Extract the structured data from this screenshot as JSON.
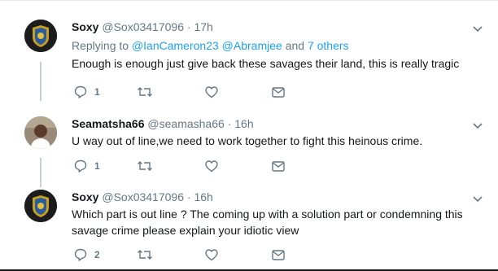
{
  "tweets": [
    {
      "name": "Soxy",
      "handle": "@Sox03417096",
      "separator": "·",
      "time": "17h",
      "reply_prefix": "Replying to",
      "reply_mentions": [
        "@IanCameron23",
        "@Abramjee"
      ],
      "reply_and": "and",
      "reply_others": "7 others",
      "text": "Enough is enough just give back these savages their land, this is really tragic",
      "reply_count": "1",
      "retweet_count": "",
      "like_count": "",
      "avatar_badge_text": "ABS-ISD"
    },
    {
      "name": "Seamatsha66",
      "handle": "@seamasha66",
      "separator": "·",
      "time": "16h",
      "text": "U way out of line,we need to work together to fight this heinous crime.",
      "reply_count": "1",
      "retweet_count": "",
      "like_count": ""
    },
    {
      "name": "Soxy",
      "handle": "@Sox03417096",
      "separator": "·",
      "time": "16h",
      "text": "Which part is out line ? The coming up with a solution part or condemning this savage crime please explain your idiotic view",
      "reply_count": "2",
      "retweet_count": "",
      "like_count": "",
      "avatar_badge_text": "ABS-ISD"
    }
  ],
  "icons": {
    "reply": "reply-icon",
    "retweet": "retweet-icon",
    "like": "heart-icon",
    "dm": "envelope-icon",
    "more": "chevron-down-icon"
  },
  "colors": {
    "link": "#1da1f2",
    "secondary_text": "#657786",
    "thread_line": "#c4cfd6"
  }
}
